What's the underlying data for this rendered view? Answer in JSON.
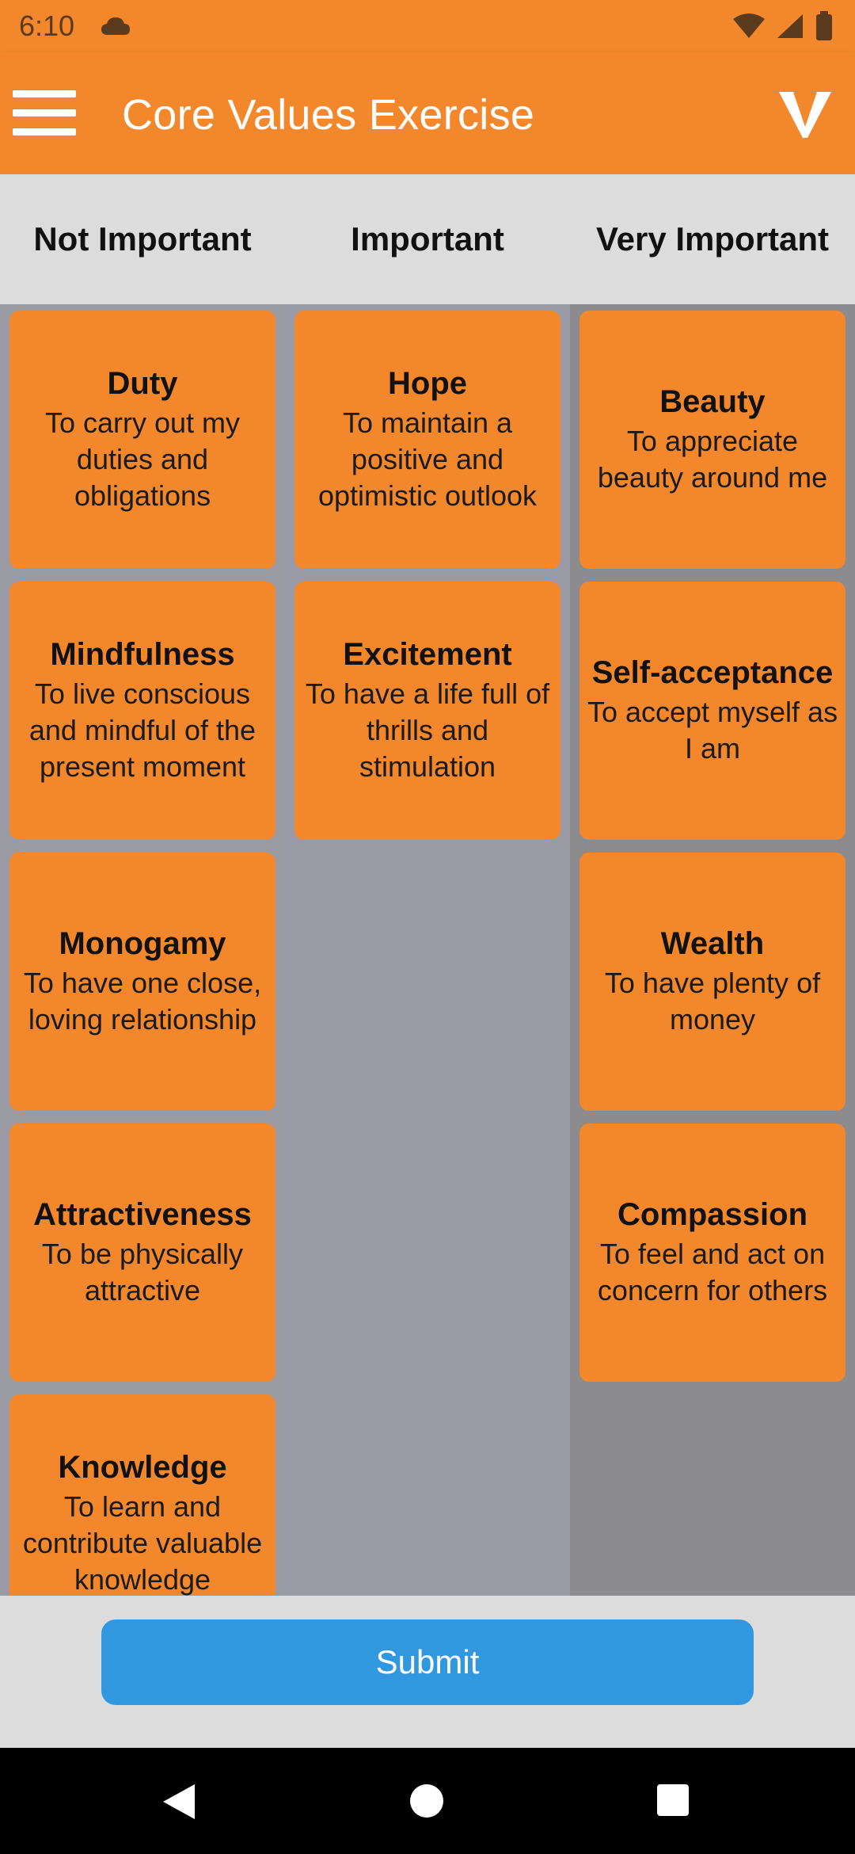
{
  "status_bar": {
    "time": "6:10"
  },
  "app_bar": {
    "title": "Core Values Exercise"
  },
  "columns": [
    {
      "label": "Not Important"
    },
    {
      "label": "Important"
    },
    {
      "label": "Very Important"
    }
  ],
  "cards": {
    "not_important": [
      {
        "title": "Duty",
        "desc": "To carry out my duties and obligations"
      },
      {
        "title": "Mindfulness",
        "desc": "To live conscious and mindful of the present moment"
      },
      {
        "title": "Monogamy",
        "desc": "To have one close, loving relationship"
      },
      {
        "title": "Attractiveness",
        "desc": "To be physically attractive"
      },
      {
        "title": "Knowledge",
        "desc": "To learn and contribute valuable knowledge"
      }
    ],
    "important": [
      {
        "title": "Hope",
        "desc": "To maintain a positive and optimistic outlook"
      },
      {
        "title": "Excitement",
        "desc": "To have a life full of thrills and stimulation"
      }
    ],
    "very_important": [
      {
        "title": "Beauty",
        "desc": "To appreciate beauty around me"
      },
      {
        "title": "Self-acceptance",
        "desc": "To accept myself as I am"
      },
      {
        "title": "Wealth",
        "desc": "To have plenty of money"
      },
      {
        "title": "Compassion",
        "desc": "To feel and act on concern for others"
      }
    ]
  },
  "footer": {
    "submit_label": "Submit"
  },
  "colors": {
    "accent": "#f2882b",
    "button": "#3197df"
  }
}
